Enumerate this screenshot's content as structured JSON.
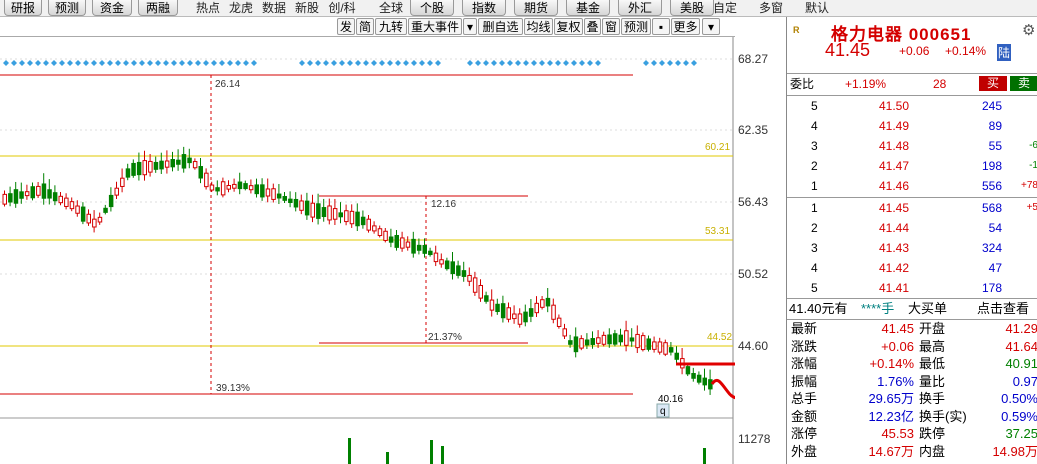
{
  "topbar": {
    "buttons": [
      {
        "label": "研报",
        "name": "research"
      },
      {
        "label": "预测",
        "name": "forecast"
      },
      {
        "label": "资金",
        "name": "funds"
      },
      {
        "label": "两融",
        "name": "margin"
      }
    ],
    "links": [
      {
        "label": "热点",
        "name": "hotspot"
      },
      {
        "label": "龙虎",
        "name": "dragon-tiger"
      },
      {
        "label": "数据",
        "name": "data"
      },
      {
        "label": "新股",
        "name": "new-stocks"
      },
      {
        "label": "创/科",
        "name": "chinext-star"
      },
      {
        "label": "全球",
        "name": "global"
      }
    ],
    "buttons2": [
      {
        "label": "个股",
        "name": "stocks"
      },
      {
        "label": "指数",
        "name": "index"
      },
      {
        "label": "期货",
        "name": "futures"
      },
      {
        "label": "基金",
        "name": "fund"
      },
      {
        "label": "外汇",
        "name": "forex"
      },
      {
        "label": "美股",
        "name": "us-stocks"
      }
    ],
    "links2": [
      {
        "label": "自定",
        "name": "custom"
      },
      {
        "label": "多窗",
        "name": "multi-window"
      },
      {
        "label": "默认",
        "name": "default"
      }
    ]
  },
  "chart_tools": [
    "发",
    "简",
    "九转",
    "重大事件",
    "▾",
    "删自选",
    "均线",
    "复权",
    "叠",
    "窗",
    "预测",
    "▪",
    "更多",
    "▾"
  ],
  "chart": {
    "y_labels": [
      "68.27",
      "62.35",
      "56.43",
      "50.52",
      "44.60",
      "11278"
    ],
    "fib_labels": [
      "60.21",
      "53.31",
      "44.52"
    ],
    "annotations": [
      "26.14",
      "12.16",
      "21.37%",
      "39.13%",
      "40.16"
    ],
    "marker_letter": "q",
    "colors": {
      "up": "#d40000",
      "down": "#008000",
      "fib": "#e0c800",
      "guide": "#d40000",
      "drawing": "#e00000"
    }
  },
  "quote": {
    "logo": "R",
    "name": "格力电器 000651",
    "price": "41.45",
    "change": "+0.06",
    "change_pct": "+0.14%",
    "market_tag": "陆",
    "weibi_label": "委比",
    "weibi_value": "+1.19%",
    "weicha_value": "28",
    "buy_btn": "买",
    "sell_btn": "卖",
    "sell_label_chars": [
      "卖",
      "盘"
    ],
    "buy_label_chars": [
      "买",
      "盘"
    ],
    "asks": [
      {
        "level": "5",
        "price": "41.50",
        "volume": "245",
        "delta": ""
      },
      {
        "level": "4",
        "price": "41.49",
        "volume": "89",
        "delta": ""
      },
      {
        "level": "3",
        "price": "41.48",
        "volume": "55",
        "delta": "-6"
      },
      {
        "level": "2",
        "price": "41.47",
        "volume": "198",
        "delta": "-1"
      },
      {
        "level": "1",
        "price": "41.46",
        "volume": "556",
        "delta": "+78"
      }
    ],
    "bids": [
      {
        "level": "1",
        "price": "41.45",
        "volume": "568",
        "delta": "+5"
      },
      {
        "level": "2",
        "price": "41.44",
        "volume": "54",
        "delta": ""
      },
      {
        "level": "3",
        "price": "41.43",
        "volume": "324",
        "delta": ""
      },
      {
        "level": "4",
        "price": "41.42",
        "volume": "47",
        "delta": ""
      },
      {
        "level": "5",
        "price": "41.41",
        "volume": "178",
        "delta": ""
      }
    ],
    "big_order": {
      "price": "41.40元有",
      "stars": "****手",
      "text": "大买单",
      "link": "点击查看"
    },
    "stats": [
      {
        "l1": "最新",
        "v1": "41.45",
        "l2": "开盘",
        "v2": "41.29"
      },
      {
        "l1": "涨跌",
        "v1": "+0.06",
        "l2": "最高",
        "v2": "41.64"
      },
      {
        "l1": "涨幅",
        "v1": "+0.14%",
        "l2": "最低",
        "v2": "40.91"
      },
      {
        "l1": "振幅",
        "v1": "1.76%",
        "l2": "量比",
        "v2": "0.97"
      },
      {
        "l1": "总手",
        "v1": "29.65万",
        "l2": "换手",
        "v2": "0.50%"
      },
      {
        "l1": "金额",
        "v1": "12.23亿",
        "l2": "换手(实)",
        "v2": "0.59%"
      },
      {
        "l1": "涨停",
        "v1": "45.53",
        "l2": "跌停",
        "v2": "37.25"
      },
      {
        "l1": "外盘",
        "v1": "14.67万",
        "l2": "内盘",
        "v2": "14.98万"
      }
    ]
  }
}
